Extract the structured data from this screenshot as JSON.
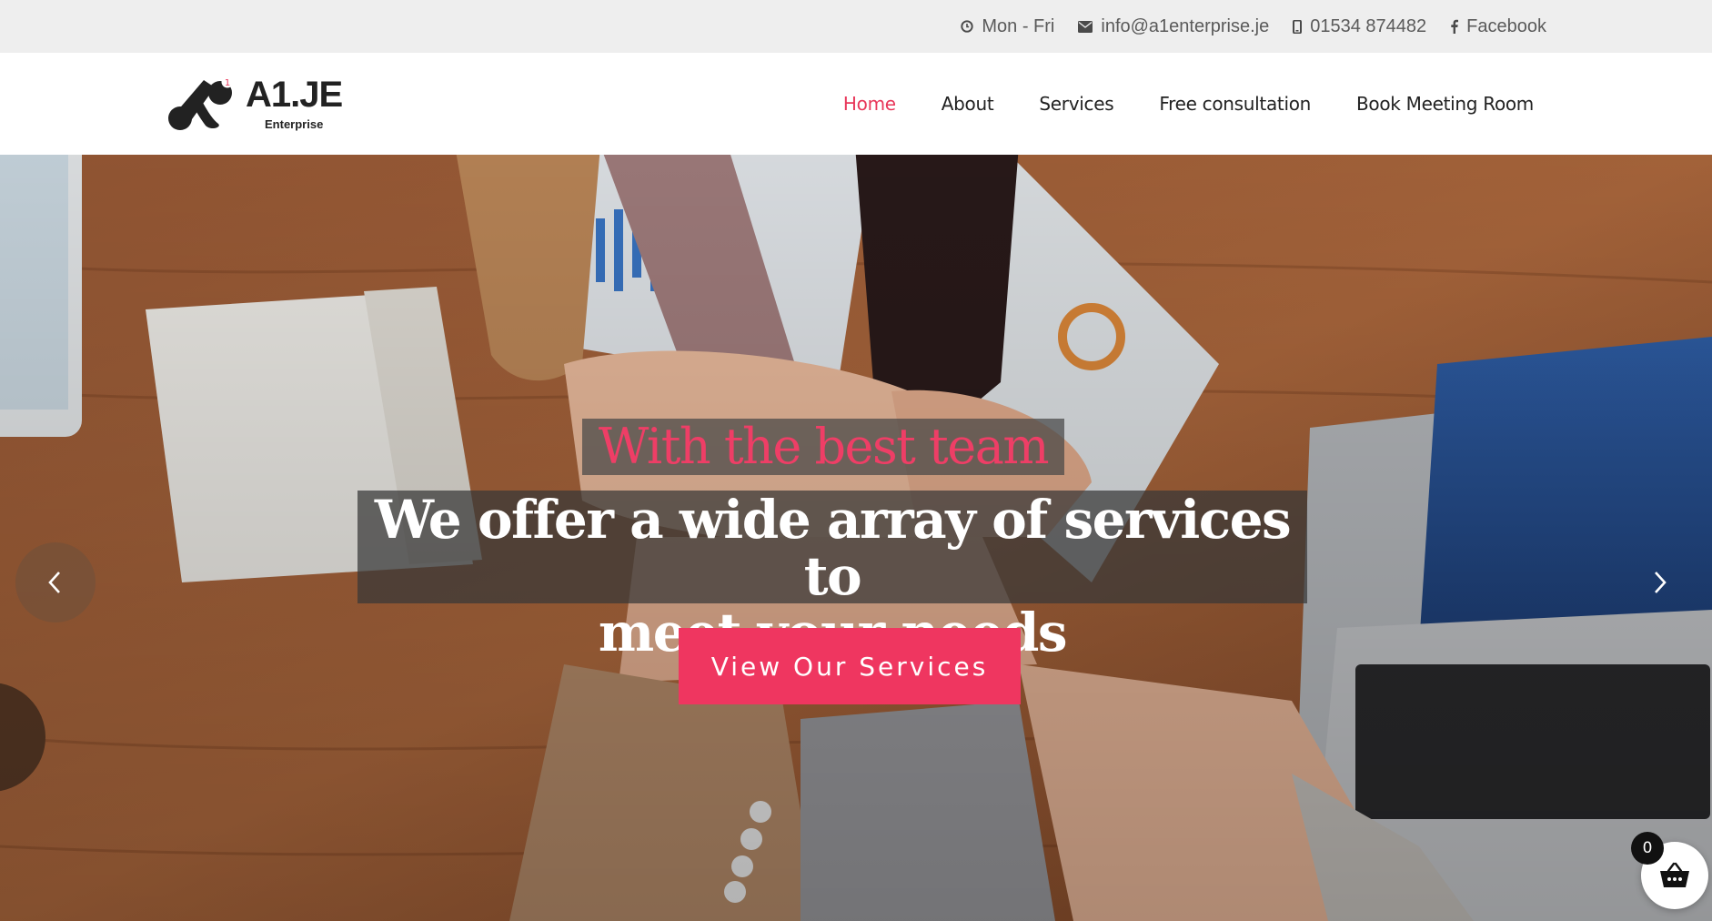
{
  "topbar": {
    "hours": "Mon - Fri",
    "email": "info@a1enterprise.je",
    "phone": "01534 874482",
    "social": "Facebook",
    "icons": [
      "clock-icon",
      "envelope-icon",
      "mobile-icon",
      "facebook-icon"
    ]
  },
  "header": {
    "logo_title": "A1.JE",
    "logo_subtitle": "Enterprise",
    "logo_badge": "1",
    "nav": [
      {
        "label": "Home",
        "active": true
      },
      {
        "label": "About",
        "active": false
      },
      {
        "label": "Services",
        "active": false
      },
      {
        "label": "Free consultation",
        "active": false
      },
      {
        "label": "Book Meeting Room",
        "active": false
      }
    ]
  },
  "hero": {
    "kicker": "With the best team",
    "title_line1": "We offer a wide array of services to",
    "title_line2": "meet your needs",
    "cta_label": "View Our Services",
    "prev_icon": "chevron-left-icon",
    "next_icon": "chevron-right-icon"
  },
  "cart": {
    "count": "0",
    "icon": "basket-icon"
  },
  "colors": {
    "accent": "#ef3660",
    "active_nav": "#e8375a",
    "topbar_bg": "#eeeeee",
    "text_dark": "#222222"
  }
}
